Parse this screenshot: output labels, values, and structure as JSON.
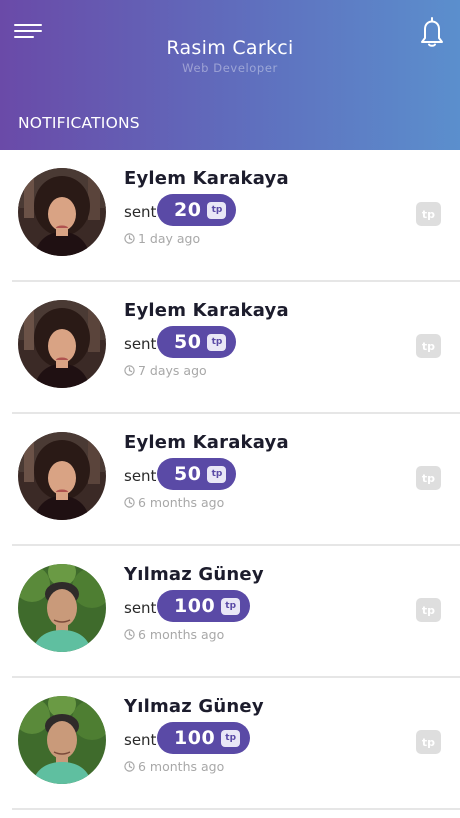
{
  "header": {
    "user_name": "Rasim Carkci",
    "user_role": "Web Developer",
    "section_title": "NOTIFICATIONS",
    "menu_icon": "hamburger-menu-icon",
    "bell_icon": "bell-icon",
    "gradient_start": "#6a4aa8",
    "gradient_end": "#5b8fcd"
  },
  "notifications": [
    {
      "sender": "Eylem Karakaya",
      "action": "sent",
      "amount": "20",
      "currency": "tp",
      "time": "1 day ago"
    },
    {
      "sender": "Eylem Karakaya",
      "action": "sent",
      "amount": "50",
      "currency": "tp",
      "time": "7 days ago"
    },
    {
      "sender": "Eylem Karakaya",
      "action": "sent",
      "amount": "50",
      "currency": "tp",
      "time": "6 months ago"
    },
    {
      "sender": "Yılmaz Güney",
      "action": "sent",
      "amount": "100",
      "currency": "tp",
      "time": "6 months ago"
    },
    {
      "sender": "Yılmaz Güney",
      "action": "sent",
      "amount": "100",
      "currency": "tp",
      "time": "6 months ago"
    }
  ],
  "colors": {
    "pill": "#5a4aa6",
    "badge": "#dedede",
    "muted_text": "#a8a8a8"
  }
}
